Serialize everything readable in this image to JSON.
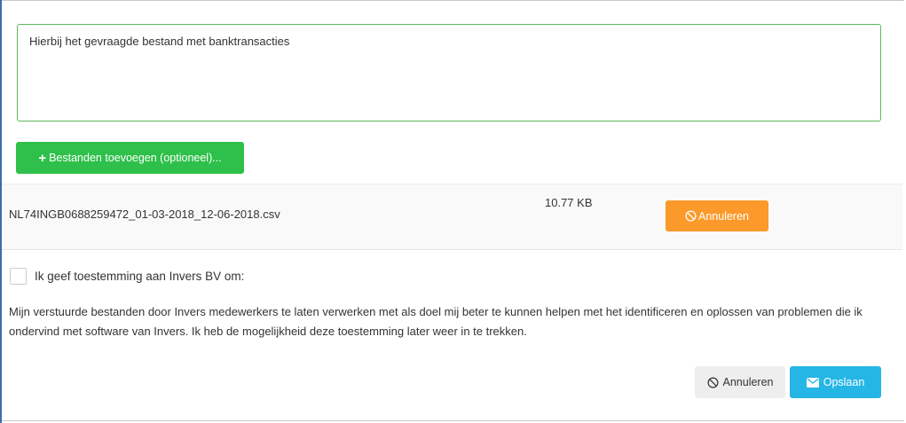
{
  "message": {
    "value": "Hierbij het gevraagde bestand met banktransacties"
  },
  "upload": {
    "add_label": "Bestanden toevoegen (optioneel)..."
  },
  "file": {
    "name": "NL74INGB0688259472_01-03-2018_12-06-2018.csv",
    "size": "10.77 KB",
    "cancel_label": "Annuleren"
  },
  "consent": {
    "checked": false,
    "label": "Ik geef toestemming aan Invers BV om:",
    "description": "Mijn verstuurde bestanden door Invers medewerkers te laten verwerken met als doel mij beter te kunnen helpen met het identificeren en oplossen van problemen die ik ondervind met software van Invers. Ik heb de mogelijkheid deze toestemming later weer in te trekken."
  },
  "footer": {
    "cancel_label": "Annuleren",
    "save_label": "Opslaan"
  },
  "colors": {
    "add_button": "#2ec04a",
    "file_cancel_button": "#fb9a2b",
    "save_button": "#25b6e6",
    "textarea_border": "#5cb85c"
  },
  "icons": {
    "add": "plus-icon",
    "file_cancel": "ban-icon",
    "footer_cancel": "ban-icon",
    "save": "envelope-icon"
  }
}
